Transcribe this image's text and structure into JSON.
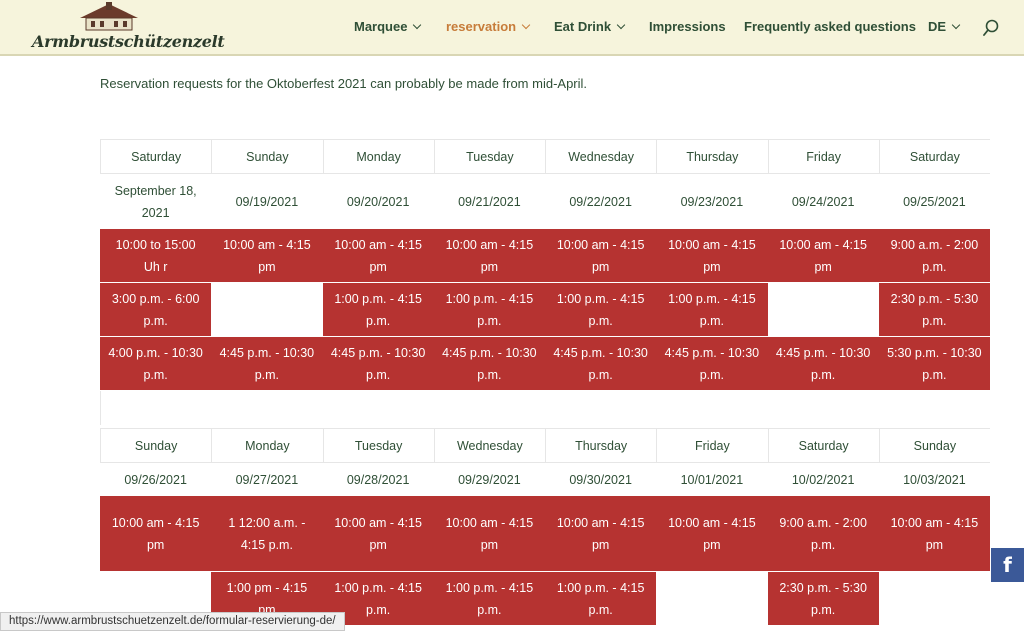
{
  "header": {
    "logo_text": "Armbrustschützenzelt",
    "nav": [
      {
        "label": "Marquee",
        "dropdown": true,
        "active": false
      },
      {
        "label": "reservation",
        "dropdown": true,
        "active": true
      },
      {
        "label": "Eat Drink",
        "dropdown": true,
        "active": false
      },
      {
        "label": "Impressions",
        "dropdown": false,
        "active": false
      },
      {
        "label": "Frequently asked questions",
        "dropdown": false,
        "active": false
      },
      {
        "label": "DE",
        "dropdown": true,
        "active": false
      }
    ],
    "search_icon": "search-icon"
  },
  "intro": "Reservation requests for the Oktoberfest 2021 can probably be made from mid-April.",
  "week1": {
    "days": [
      "Saturday",
      "Sunday",
      "Monday",
      "Tuesday",
      "Wednesday",
      "Thursday",
      "Friday",
      "Saturday"
    ],
    "dates": [
      "September 18, 2021",
      "09/19/2021",
      "09/20/2021",
      "09/21/2021",
      "09/22/2021",
      "09/23/2021",
      "09/24/2021",
      "09/25/2021"
    ],
    "slots": [
      [
        "10:00 to 15:00 Uh r",
        "10:00 am - 4:15 pm",
        "10:00 am - 4:15 pm",
        "10:00 am - 4:15 pm",
        "10:00 am - 4:15 pm",
        "10:00 am - 4:15 pm",
        "10:00 am - 4:15 pm",
        "9:00 a.m. - 2:00 p.m."
      ],
      [
        "3:00 p.m. - 6:00 p.m.",
        "",
        "1:00 p.m. - 4:15 p.m.",
        "1:00 p.m. - 4:15 p.m.",
        "1:00 p.m. - 4:15 p.m.",
        "1:00 p.m. - 4:15 p.m.",
        "",
        "2:30 p.m. - 5:30 p.m."
      ],
      [
        "4:00 p.m. - 10:30 p.m.",
        "4:45 p.m. - 10:30 p.m.",
        "4:45 p.m. - 10:30 p.m.",
        "4:45 p.m. - 10:30 p.m.",
        "4:45 p.m. - 10:30 p.m.",
        "4:45 p.m. - 10:30 p.m.",
        "4:45 p.m. - 10:30 p.m.",
        "5:30 p.m. - 10:30 p.m."
      ]
    ]
  },
  "week2": {
    "days": [
      "Sunday",
      "Monday",
      "Tuesday",
      "Wednesday",
      "Thursday",
      "Friday",
      "Saturday",
      "Sunday"
    ],
    "dates": [
      "09/26/2021",
      "09/27/2021",
      "09/28/2021",
      "09/29/2021",
      "09/30/2021",
      "10/01/2021",
      "10/02/2021",
      "10/03/2021"
    ],
    "slots": [
      [
        "10:00 am - 4:15 pm",
        "1 12:00 a.m. - 4:15 p.m.",
        "10:00 am - 4:15 pm",
        "10:00 am - 4:15 pm",
        "10:00 am - 4:15 pm",
        "10:00 am - 4:15 pm",
        "9:00 a.m. - 2:00 p.m.",
        "10:00 am - 4:15 pm"
      ],
      [
        "",
        "1:00 pm - 4:15 pm",
        "1:00 p.m. - 4:15 p.m.",
        "1:00 p.m. - 4:15 p.m.",
        "1:00 p.m. - 4:15 p.m.",
        "",
        "2:30 p.m. - 5:30 p.m.",
        ""
      ]
    ]
  },
  "facebook_label": "f",
  "status_url": "https://www.armbrustschuetzenzelt.de/formular-reservierung-de/",
  "colors": {
    "slot_red": "#b63331",
    "nav_active": "#c77c3a",
    "header_bg": "#f6f4dc"
  }
}
